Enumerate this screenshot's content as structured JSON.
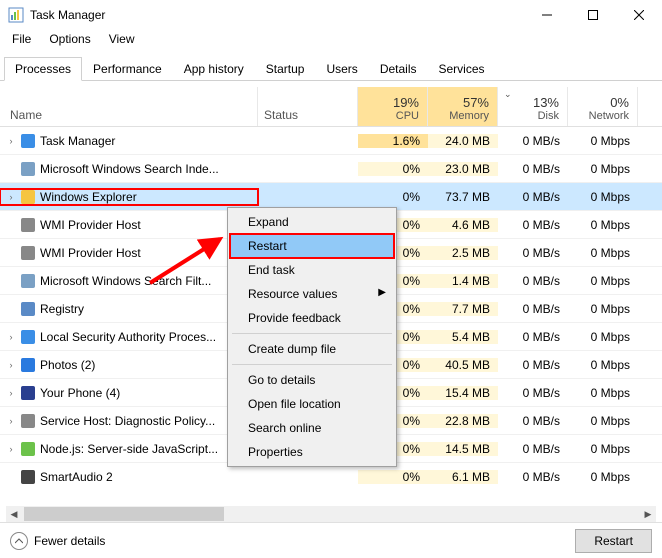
{
  "window": {
    "title": "Task Manager"
  },
  "menubar": [
    "File",
    "Options",
    "View"
  ],
  "tabs": [
    "Processes",
    "Performance",
    "App history",
    "Startup",
    "Users",
    "Details",
    "Services"
  ],
  "columns": {
    "name": "Name",
    "status": "Status",
    "cpu": {
      "pct": "19%",
      "label": "CPU"
    },
    "memory": {
      "pct": "57%",
      "label": "Memory"
    },
    "disk": {
      "pct": "13%",
      "label": "Disk"
    },
    "network": {
      "pct": "0%",
      "label": "Network"
    }
  },
  "rows": [
    {
      "exp": true,
      "icon": "taskmgr",
      "name": "Task Manager",
      "cpu": "1.6%",
      "mem": "24.0 MB",
      "disk": "0 MB/s",
      "net": "0 Mbps",
      "cpuHot": true
    },
    {
      "exp": false,
      "icon": "search",
      "name": "Microsoft Windows Search Inde...",
      "cpu": "0%",
      "mem": "23.0 MB",
      "disk": "0 MB/s",
      "net": "0 Mbps"
    },
    {
      "exp": true,
      "icon": "explorer",
      "name": "Windows Explorer",
      "cpu": "0%",
      "mem": "73.7 MB",
      "disk": "0 MB/s",
      "net": "0 Mbps",
      "selected": true,
      "redbox": true
    },
    {
      "exp": false,
      "icon": "wmi",
      "name": "WMI Provider Host",
      "cpu": "0%",
      "mem": "4.6 MB",
      "disk": "0 MB/s",
      "net": "0 Mbps"
    },
    {
      "exp": false,
      "icon": "wmi",
      "name": "WMI Provider Host",
      "cpu": "0%",
      "mem": "2.5 MB",
      "disk": "0 MB/s",
      "net": "0 Mbps"
    },
    {
      "exp": false,
      "icon": "search",
      "name": "Microsoft Windows Search Filt...",
      "cpu": "0%",
      "mem": "1.4 MB",
      "disk": "0 MB/s",
      "net": "0 Mbps"
    },
    {
      "exp": false,
      "icon": "registry",
      "name": "Registry",
      "cpu": "0%",
      "mem": "7.7 MB",
      "disk": "0 MB/s",
      "net": "0 Mbps"
    },
    {
      "exp": true,
      "icon": "shield",
      "name": "Local Security Authority Proces...",
      "cpu": "0%",
      "mem": "5.4 MB",
      "disk": "0 MB/s",
      "net": "0 Mbps"
    },
    {
      "exp": true,
      "icon": "photos",
      "name": "Photos (2)",
      "cpu": "0%",
      "mem": "40.5 MB",
      "disk": "0 MB/s",
      "net": "0 Mbps"
    },
    {
      "exp": true,
      "icon": "phone",
      "name": "Your Phone (4)",
      "cpu": "0%",
      "mem": "15.4 MB",
      "disk": "0 MB/s",
      "net": "0 Mbps"
    },
    {
      "exp": true,
      "icon": "gear",
      "name": "Service Host: Diagnostic Policy...",
      "cpu": "0%",
      "mem": "22.8 MB",
      "disk": "0 MB/s",
      "net": "0 Mbps"
    },
    {
      "exp": true,
      "icon": "node",
      "name": "Node.js: Server-side JavaScript...",
      "cpu": "0%",
      "mem": "14.5 MB",
      "disk": "0 MB/s",
      "net": "0 Mbps"
    },
    {
      "exp": false,
      "icon": "audio",
      "name": "SmartAudio 2",
      "cpu": "0%",
      "mem": "6.1 MB",
      "disk": "0 MB/s",
      "net": "0 Mbps"
    }
  ],
  "context_menu": [
    {
      "label": "Expand"
    },
    {
      "label": "Restart",
      "hover": true,
      "redbox": true
    },
    {
      "label": "End task"
    },
    {
      "label": "Resource values",
      "sub": true
    },
    {
      "label": "Provide feedback"
    },
    {
      "sep": true
    },
    {
      "label": "Create dump file"
    },
    {
      "sep": true
    },
    {
      "label": "Go to details"
    },
    {
      "label": "Open file location"
    },
    {
      "label": "Search online"
    },
    {
      "label": "Properties"
    }
  ],
  "footer": {
    "fewer": "Fewer details",
    "restart": "Restart"
  },
  "icons": {
    "taskmgr": "#3a8ee6",
    "search": "#7aa0c4",
    "explorer": "#f5c542",
    "wmi": "#888",
    "registry": "#5a8ac6",
    "shield": "#3a8ee6",
    "photos": "#2a7adf",
    "phone": "#2a3f8f",
    "gear": "#888",
    "node": "#6cc24a",
    "audio": "#444"
  }
}
